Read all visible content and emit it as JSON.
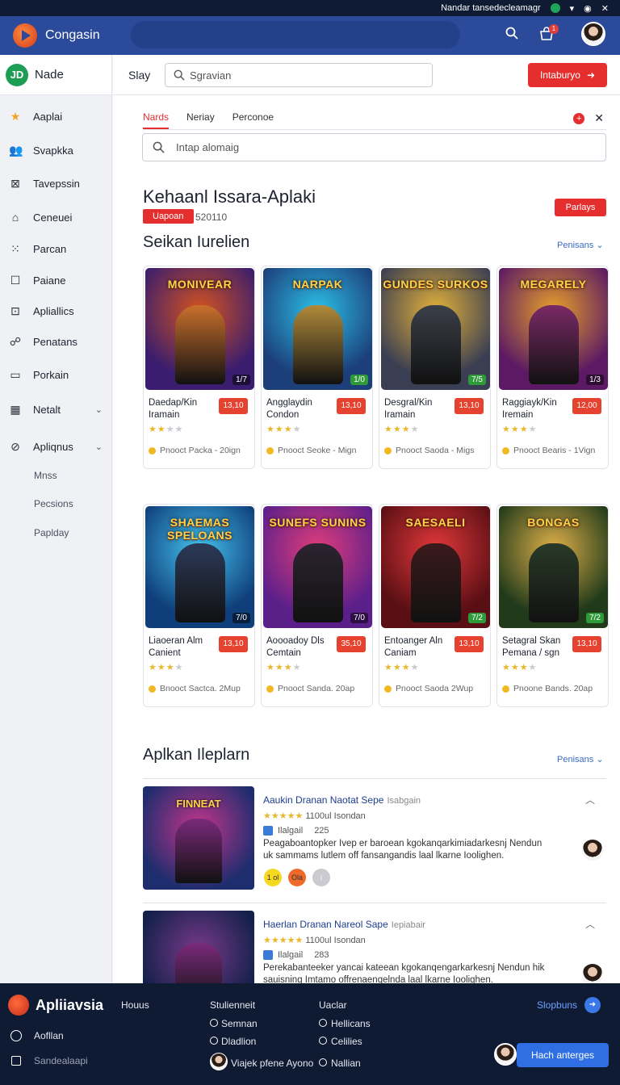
{
  "status": {
    "text": "Nandar tansedecleamagr"
  },
  "topbar": {
    "brand": "Congasin",
    "cart_badge": "1"
  },
  "sidebar": {
    "user": {
      "initials": "JD",
      "name": "Nade"
    },
    "items": [
      {
        "label": "Aaplai",
        "icon": "star-icon"
      },
      {
        "label": "Svapkka",
        "icon": "users-icon"
      },
      {
        "label": "Tavepssin",
        "icon": "cross-box-icon"
      },
      {
        "label": "Ceneuei",
        "icon": "bag-icon"
      },
      {
        "label": "Parcan",
        "icon": "grid-icon"
      },
      {
        "label": "Paiane",
        "icon": "square-icon"
      },
      {
        "label": "Apliallics",
        "icon": "dot-square-icon"
      },
      {
        "label": "Penatans",
        "icon": "fingerprint-icon"
      },
      {
        "label": "Porkain",
        "icon": "screen-badge-icon"
      },
      {
        "label": "Netalt",
        "icon": "building-icon"
      },
      {
        "label": "Apliqnus",
        "icon": "block-icon"
      }
    ],
    "subitems": [
      "Mnss",
      "Pecsions",
      "Paplday"
    ]
  },
  "header": {
    "label": "Slay",
    "search_placeholder": "Sgravian",
    "action_label": "Intaburyo"
  },
  "tabs": [
    {
      "label": "Nards",
      "active": true
    },
    {
      "label": "Neriay",
      "active": false
    },
    {
      "label": "Perconoe",
      "active": false
    }
  ],
  "filter": {
    "placeholder": "Intap alomaig"
  },
  "section1": {
    "title": "Kehaanl Issara-Aplaki",
    "tag": "Uapoan",
    "number": "520110",
    "action": "Parlays",
    "subtitle": "Seikan Iurelien",
    "more": "Penisans"
  },
  "games": [
    {
      "art_title": "MONIVEAR",
      "score": "1/7",
      "score_green": false,
      "name": "Daedap/Kin Iramain",
      "price": "13,10",
      "stars": 2,
      "meta": "Pnooct Packa - 20ign",
      "bg": [
        "#3a1d6e",
        "#d4531f"
      ],
      "fig": "#c9702c"
    },
    {
      "art_title": "NARPAK",
      "score": "1/0",
      "score_green": true,
      "name": "Angglaydin Condon",
      "price": "13,10",
      "stars": 3,
      "meta": "Pnooct Seoke - Mign",
      "bg": [
        "#1c3f7a",
        "#2cc0e8"
      ],
      "fig": "#b08a3a"
    },
    {
      "art_title": "GUNDES SURKOS",
      "score": "7/5",
      "score_green": true,
      "name": "Desgral/Kin Iramain",
      "price": "13,10",
      "stars": 3,
      "meta": "Pnooct Saoda - Migs",
      "bg": [
        "#3a3e52",
        "#e4b23a"
      ],
      "fig": "#3b3f48"
    },
    {
      "art_title": "MEGARELY",
      "score": "1/3",
      "score_green": false,
      "name": "Raggiayk/Kin Iremain",
      "price": "12,00",
      "stars": 3,
      "meta": "Pnooct Bearis - 1Vign",
      "bg": [
        "#5b1a63",
        "#e8a02a"
      ],
      "fig": "#7a2a66"
    },
    {
      "art_title": "SHAEMAS SPELOANS",
      "score": "7/0",
      "score_green": false,
      "name": "Liaoeran Alm Canient",
      "price": "13,10",
      "stars": 3,
      "meta": "Bnooct Sactca. 2Mup",
      "bg": [
        "#0f3f7a",
        "#45c3ef"
      ],
      "fig": "#2c3a58"
    },
    {
      "art_title": "SUNEFS SUNINS",
      "score": "7/0",
      "score_green": false,
      "name": "Aoooadoy Dls Cemtain",
      "price": "35,10",
      "stars": 3,
      "meta": "Pnooct Sanda. 20ap",
      "bg": [
        "#5b1f8a",
        "#e03d7a"
      ],
      "fig": "#2c2430"
    },
    {
      "art_title": "SAESAELI",
      "score": "7/2",
      "score_green": true,
      "name": "Entoanger Aln Caniam",
      "price": "13,10",
      "stars": 3,
      "meta": "Pnooct Saoda 2Wup",
      "bg": [
        "#5a0f14",
        "#e2383a"
      ],
      "fig": "#3b1a1c"
    },
    {
      "art_title": "BONGAS",
      "score": "7/2",
      "score_green": true,
      "name": "Setagral Skan Pemana / sgn",
      "price": "13,10",
      "stars": 3,
      "meta": "Pnoone Bands. 20ap",
      "bg": [
        "#203a1a",
        "#e0b04a"
      ],
      "fig": "#2a3a28"
    }
  ],
  "section2": {
    "title": "Aplkan Ileplarn",
    "more": "Penisans",
    "items": [
      {
        "title": "Aaukin Dranan Naotat Sepe",
        "tag": "Isabgain",
        "rating": "1100ul Isondan",
        "chip": "Ilalgail",
        "chip_num": "225",
        "desc": "Peagaboantopker Ivep er baroean kgokanqarkimiadarkesnj Nendun uk sammams lutlem off fansangandis laal lkarne Ioolighen.",
        "art_text": "FINNEAT",
        "bg": [
          "#1d2d6e",
          "#c4358a"
        ],
        "dots": [
          "1 ol",
          "Ola",
          "i"
        ]
      },
      {
        "title": "Haerlan Dranan Nareol Sape",
        "tag": "Iepiabair",
        "rating": "1100ul Isondan",
        "chip": "Ilalgail",
        "chip_num": "283",
        "desc": "Perekabanteeker yancai kateean kgokanqengarkarkesnj Nendun hik sauisning Imtamo offrenaengelnda laal lkarne Ioolighen.",
        "art_text": "",
        "bg": [
          "#12204a",
          "#7a3a8a"
        ],
        "dots": []
      }
    ]
  },
  "footer": {
    "brand": "Apliiavsia",
    "col1": "Houus",
    "col2_head": "Stulienneit",
    "col2": [
      "Semnan",
      "Dladlion"
    ],
    "col2_user": "Viajek pfene Ayono",
    "col3_head": "Uaclar",
    "col3": [
      "Hellicans",
      "Celilies",
      "Nallian"
    ],
    "left_links": [
      "Aofllan",
      "Sandealaapi"
    ],
    "link": "Slopbuns",
    "button": "Hach anterges"
  }
}
